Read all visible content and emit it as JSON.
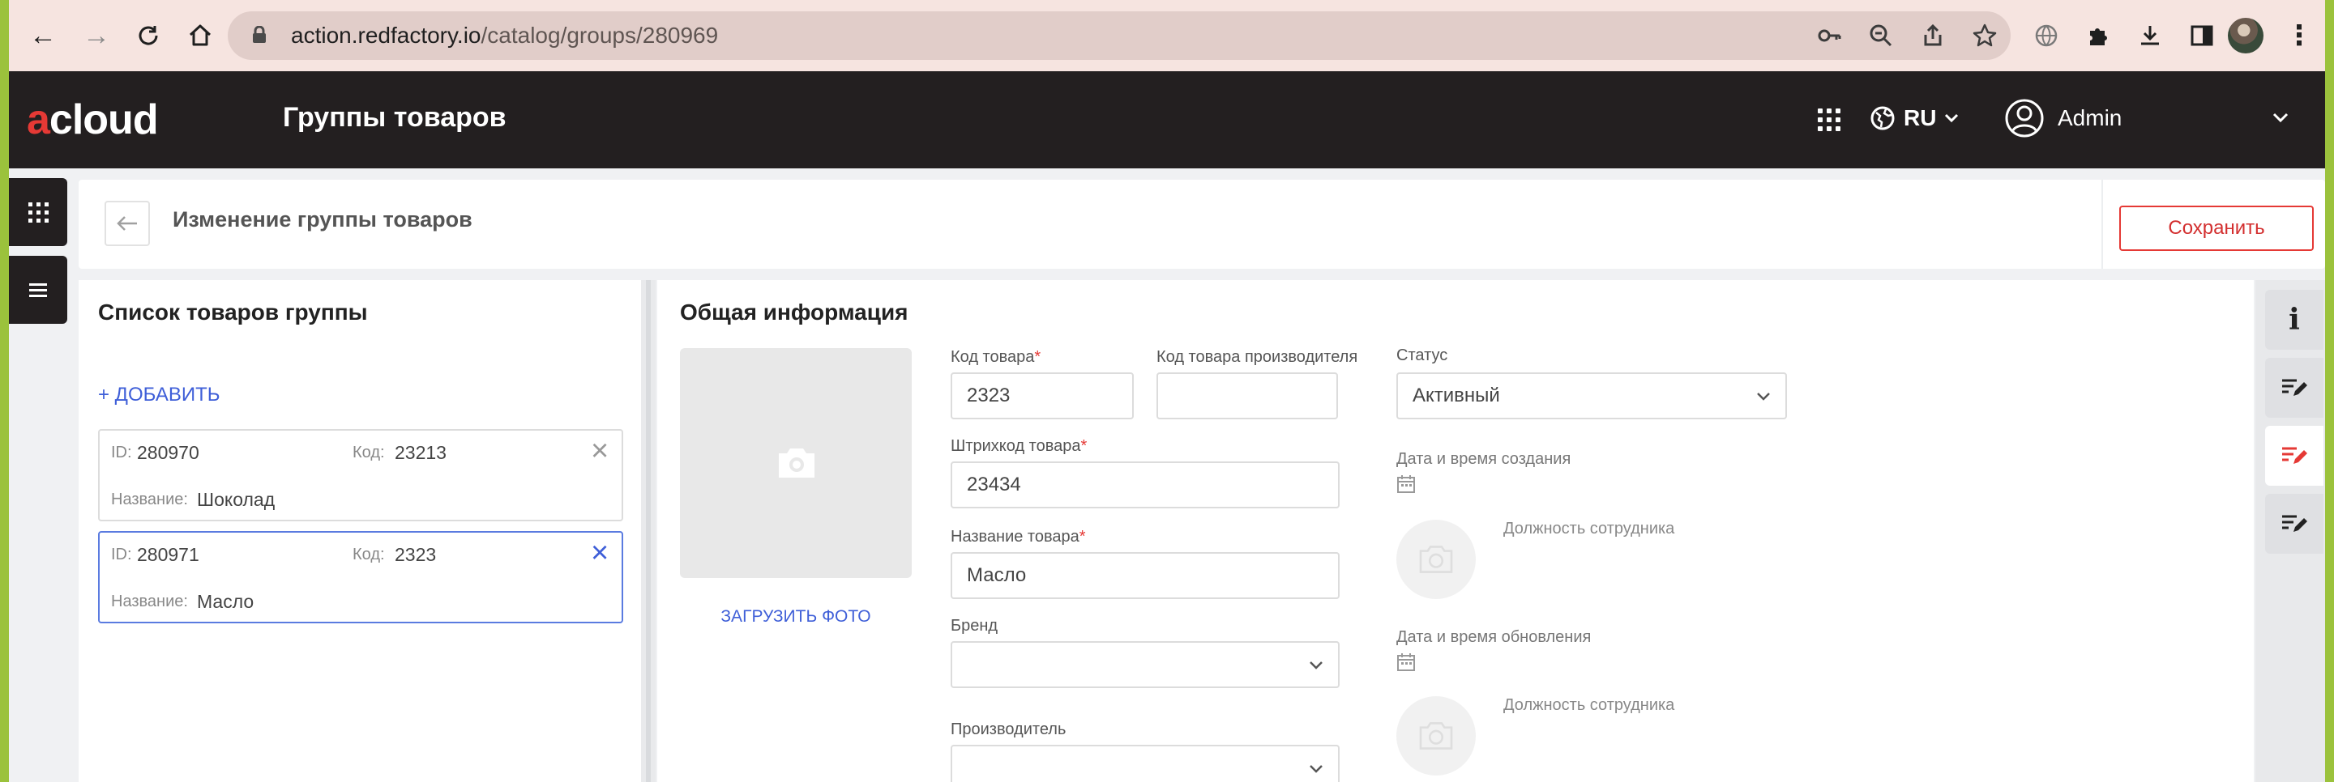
{
  "browser": {
    "url_host": "action.redfactory.io",
    "url_path": "/catalog/groups/280969"
  },
  "app": {
    "logo_a": "a",
    "logo_rest": "cloud",
    "page_title": "Группы товаров",
    "language": "RU",
    "user_name": "Admin"
  },
  "edit_bar": {
    "title": "Изменение группы товаров",
    "save_label": "Сохранить"
  },
  "left_panel": {
    "title": "Список товаров группы",
    "add_label": "+ ДОБАВИТЬ",
    "items": [
      {
        "id_label": "ID:",
        "id": "280970",
        "code_label": "Код:",
        "code": "23213",
        "name_label": "Название:",
        "name": "Шоколад"
      },
      {
        "id_label": "ID:",
        "id": "280971",
        "code_label": "Код:",
        "code": "2323",
        "name_label": "Название:",
        "name": "Масло"
      }
    ]
  },
  "right_panel": {
    "title": "Общая информация",
    "upload_label": "ЗАГРУЗИТЬ ФОТО",
    "fields": {
      "code_label": "Код товара",
      "code_value": "2323",
      "mfr_code_label": "Код товара производителя",
      "mfr_code_value": "",
      "barcode_label": "Штрихкод товара",
      "barcode_value": "23434",
      "name_label": "Название товара",
      "name_value": "Масло",
      "brand_label": "Бренд",
      "brand_value": "",
      "manufacturer_label": "Производитель",
      "manufacturer_value": "",
      "status_label": "Статус",
      "status_value": "Активный",
      "created_label": "Дата и время создания",
      "created_position": "Должность сотрудника",
      "updated_label": "Дата и время обновления",
      "updated_position": "Должность сотрудника"
    },
    "required_mark": "*"
  },
  "rail": {
    "info_glyph": "i"
  },
  "colors": {
    "accent_red": "#e53935",
    "link_blue": "#3f5fd8",
    "header_dark": "#231f20"
  }
}
